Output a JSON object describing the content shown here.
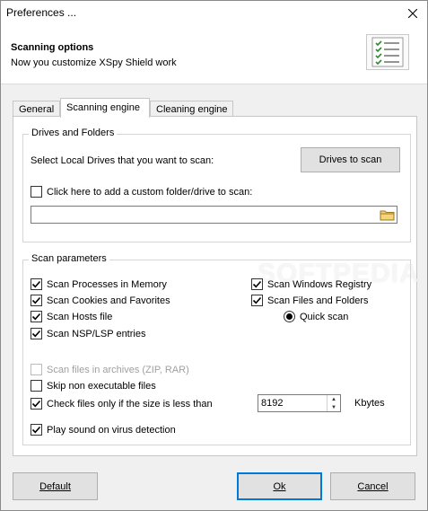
{
  "window": {
    "title": "Preferences ...",
    "close_glyph": "✕"
  },
  "header": {
    "title": "Scanning options",
    "subtitle": "Now you customize XSpy Shield work",
    "icon": "checklist-icon"
  },
  "tabs": [
    {
      "label": "General",
      "active": false
    },
    {
      "label": "Scanning engine",
      "active": true
    },
    {
      "label": "Cleaning engine",
      "active": false
    }
  ],
  "drives": {
    "legend": "Drives and Folders",
    "select_label": "Select Local Drives that you want to scan:",
    "scan_button": "Drives to scan",
    "custom_label": "Click here to add a custom folder/drive to scan:",
    "custom_checked": false,
    "path_value": "",
    "browse_icon": "folder-icon"
  },
  "watermark": "SOFTPEDIA",
  "params": {
    "legend": "Scan parameters",
    "left": [
      {
        "label": "Scan Processes in Memory",
        "checked": true
      },
      {
        "label": "Scan Cookies and Favorites",
        "checked": true
      },
      {
        "label": "Scan Hosts file",
        "checked": true
      },
      {
        "label": "Scan NSP/LSP entries",
        "checked": true
      }
    ],
    "right": [
      {
        "label": "Scan Windows Registry",
        "checked": true
      },
      {
        "label": "Scan Files and Folders",
        "checked": true
      }
    ],
    "quick_scan": {
      "label": "Quick scan",
      "selected": true
    },
    "archives": {
      "label": "Scan files in archives (ZIP, RAR)",
      "checked": false,
      "disabled": true
    },
    "skip_nonexec": {
      "label": "Skip non executable files",
      "checked": false
    },
    "size_limit": {
      "label": "Check files only if the size is less than",
      "checked": true,
      "value": "8192",
      "unit": "Kbytes"
    },
    "play_sound": {
      "label": "Play sound on virus detection",
      "checked": true
    }
  },
  "footer": {
    "default_button": "Default",
    "ok_button": "Ok",
    "cancel_button": "Cancel"
  }
}
